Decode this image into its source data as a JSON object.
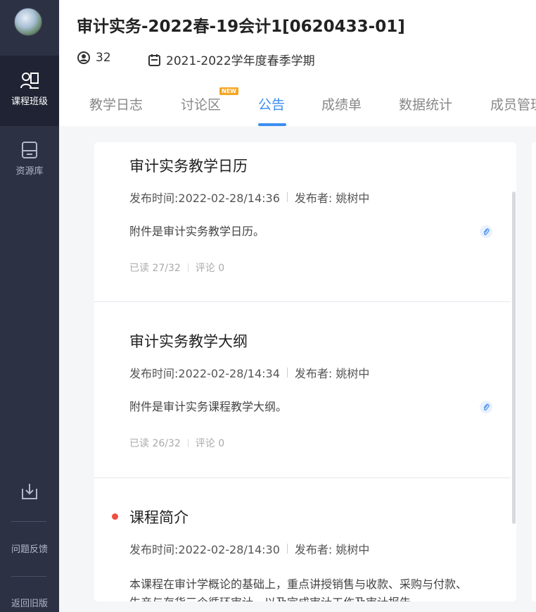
{
  "sidebar": {
    "courses_label": "课程班级",
    "resources_label": "资源库",
    "feedback_label": "问题反馈",
    "old_version_label": "返回旧版"
  },
  "header": {
    "course_title": "审计实务-2022春-19会计1[0620433-01]",
    "member_count": "32",
    "term": "2021-2022学年度春季学期",
    "tabs": [
      {
        "label": "教学日志"
      },
      {
        "label": "讨论区",
        "badge": "NEW"
      },
      {
        "label": "公告"
      },
      {
        "label": "成绩单"
      },
      {
        "label": "数据统计"
      },
      {
        "label": "成员管理"
      }
    ]
  },
  "announcements": [
    {
      "title": "审计实务教学日历",
      "published": "发布时间:2022-02-28/14:36",
      "publisher": "发布者: 姚树中",
      "body": "附件是审计实务教学日历。",
      "read": "已读 27/32",
      "comments": "评论 0"
    },
    {
      "title": "审计实务教学大纲",
      "published": "发布时间:2022-02-28/14:34",
      "publisher": "发布者: 姚树中",
      "body": "附件是审计实务课程教学大纲。",
      "read": "已读 26/32",
      "comments": "评论 0"
    },
    {
      "title": "课程简介",
      "published": "发布时间:2022-02-28/14:30",
      "publisher": "发布者: 姚树中",
      "body": "本课程在审计学概论的基础上，重点讲授销售与收款、采购与付款、生产与存货三个循环审计，以及完成审计工作及审计报告。"
    }
  ],
  "colors": {
    "sidebar_bg": "#2c3143",
    "active_tab": "#3b8ef0",
    "unread_dot": "#f04e3e",
    "new_badge": "#f5a623"
  }
}
